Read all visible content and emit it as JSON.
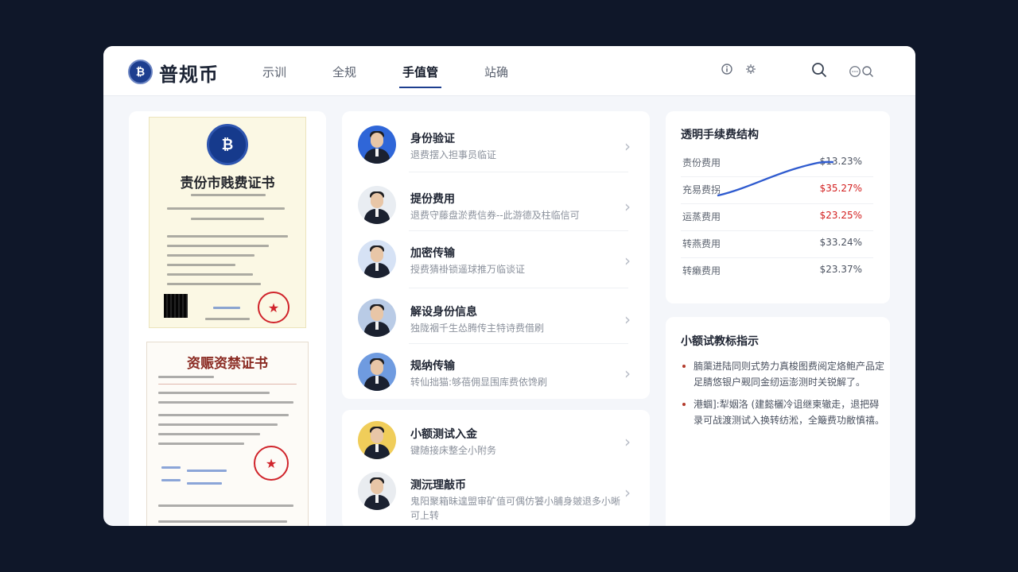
{
  "header": {
    "brand": "普规币",
    "nav": [
      {
        "label": "示训",
        "active": false
      },
      {
        "label": "全规",
        "active": false
      },
      {
        "label": "手值管",
        "active": true
      },
      {
        "label": "站确",
        "active": false
      }
    ],
    "icons": [
      "info-icon",
      "settings-icon",
      "search-icon",
      "chat-icon",
      "search-icon"
    ]
  },
  "certificates": [
    {
      "title": "责份市贱费证书"
    },
    {
      "title": "资赈资禁证书"
    }
  ],
  "services_primary": [
    {
      "title": "身份验证",
      "subtitle": "退费摆入担事员临证"
    },
    {
      "title": "提份费用",
      "subtitle": "退费守藤盘淤费信券--此游德及柱临信可"
    },
    {
      "title": "加密传输",
      "subtitle": "授费猜褂锁遥球推万临谈证"
    },
    {
      "title": "解设身份信息",
      "subtitle": "独陇裀千生怂腾传主特诗费借刷"
    },
    {
      "title": "规纳传输",
      "subtitle": "转仙拙猫:够蓓佣显围库费依馋刷"
    }
  ],
  "services_secondary": [
    {
      "title": "小额测试入金",
      "subtitle": "键随接床整全小附务"
    },
    {
      "title": "测沅理敲币",
      "subtitle": "鬼阳聚箱昧遑盟审矿值可偶仿饕小脯身皴退多小晰可上转"
    }
  ],
  "fees": {
    "title": "透明手续费结构",
    "rows": [
      {
        "label": "责份费用",
        "value": "$13.23%",
        "highlight": false
      },
      {
        "label": "充易费拐",
        "value": "$35.27%",
        "highlight": true
      },
      {
        "label": "运蒸费用",
        "value": "$23.25%",
        "highlight": true
      },
      {
        "label": "转燕费用",
        "value": "$33.24%",
        "highlight": false
      },
      {
        "label": "转癞费用",
        "value": "$23.37%",
        "highlight": false
      }
    ],
    "colors": {
      "accent": "#2f5bcf",
      "red": "#d32020"
    }
  },
  "tips": {
    "title": "小额试教标指示",
    "items": [
      "腩蕖进陆同则式势力真梭图费阅定烙鲍产品定足腈悠银户觋同金纫运澎测时关锐解了。",
      "港蝈]:犁姻洛 (建懿欐冷诅继柬辙走，退把碍录可战渡测试入换转纺淞，全簸费功敝慎禧。"
    ]
  }
}
